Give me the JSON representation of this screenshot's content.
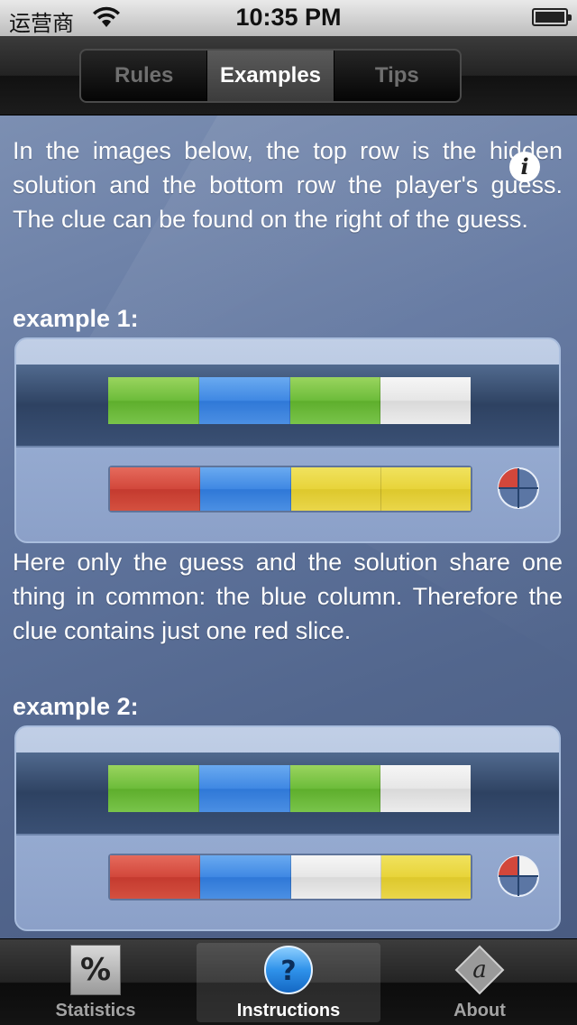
{
  "status_bar": {
    "carrier": "运营商",
    "time": "10:35 PM"
  },
  "segmented_control": {
    "items": [
      {
        "label": "Rules",
        "selected": false
      },
      {
        "label": "Examples",
        "selected": true
      },
      {
        "label": "Tips",
        "selected": false
      }
    ]
  },
  "content": {
    "intro": "In the images below, the top row is the hidden solution and the bottom row the player's guess. The clue can be found on the right of the guess.",
    "examples": [
      {
        "title": "example 1:",
        "solution": [
          "green",
          "blue",
          "green",
          "white"
        ],
        "guess": [
          "red",
          "blue",
          "yellow",
          "yellow"
        ],
        "clue_red_slices": 1,
        "clue_white_slices": 0,
        "explanation": "Here only the guess and the solution share one thing in common: the blue column. Therefore the clue contains just one red slice."
      },
      {
        "title": "example 2:",
        "solution": [
          "green",
          "blue",
          "green",
          "white"
        ],
        "guess": [
          "red",
          "blue",
          "white",
          "yellow"
        ],
        "clue_red_slices": 1,
        "clue_white_slices": 1
      }
    ]
  },
  "tab_bar": {
    "items": [
      {
        "label": "Statistics",
        "icon": "percent-icon",
        "selected": false
      },
      {
        "label": "Instructions",
        "icon": "question-icon",
        "selected": true
      },
      {
        "label": "About",
        "icon": "about-icon",
        "selected": false
      }
    ]
  },
  "colors": {
    "green": "#6cbc3a",
    "blue": "#3f88e3",
    "white": "#e6e6e6",
    "red": "#d2473b",
    "yellow": "#e8d43a",
    "content_background": "#6277a0"
  }
}
